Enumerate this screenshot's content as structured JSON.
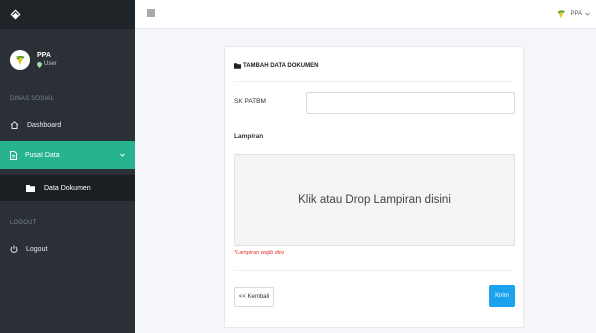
{
  "sidebar": {
    "user": {
      "name": "PPA",
      "role": "User"
    },
    "section_main": "DINAS SOSIAL",
    "items": [
      {
        "label": "Dashboard"
      },
      {
        "label": "Pusat Data"
      }
    ],
    "sub_items": [
      {
        "label": "Data Dokumen"
      }
    ],
    "section_logout": "LOGOUT",
    "logout_label": "Logout"
  },
  "topbar": {
    "user_label": "PPA"
  },
  "form": {
    "title": "TAMBAH DATA DOKUMEN",
    "sk_label": "SK PATBM",
    "sk_value": "",
    "sk_placeholder": "",
    "lampiran_label": "Lampiran",
    "dropzone_text": "Klik atau Drop Lampiran disini",
    "warning": "*Lampiran wajib diisi",
    "back_label": "<< Kembali",
    "submit_label": "Kirim"
  },
  "colors": {
    "sidebar_bg": "#2a3035",
    "active_item": "#26b38e",
    "submit_button": "#1aa3ec",
    "warning_text": "#e0342d"
  },
  "icons": [
    "brand-logo-icon",
    "home-icon",
    "file-icon",
    "folder-icon",
    "power-icon",
    "menu-icon",
    "map-marker-icon",
    "chevron-down-icon"
  ]
}
